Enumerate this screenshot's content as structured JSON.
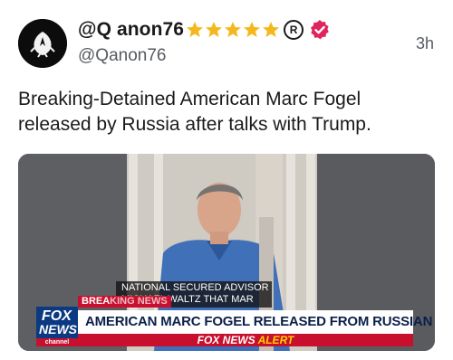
{
  "post": {
    "display_name": "@Q anon76",
    "handle": "@Qanon76",
    "timestamp": "3h",
    "text": "Breaking-Detained American Marc Fogel released by Russia after talks with Trump.",
    "star_count": 5,
    "registered_symbol": "R"
  },
  "media": {
    "caption_line_1": "NATIONAL SECURED ADVISOR",
    "caption_line_2": "MICHAEL WALTZ THAT MAR",
    "breaking_label": "BREA",
    "breaking_tail": "KING NEWS",
    "headline": "AMERICAN MARC FOGEL RELEASED FROM RUSSIAN CUSTODY",
    "logo_fox": "FOX",
    "logo_news": "NEWS",
    "logo_channel": "channel",
    "alert_brand": "FOX NEWS",
    "alert_word": "ALERT"
  },
  "colors": {
    "star": "#f5b81c",
    "verified": "#e0245e",
    "fox_blue": "#0b3a82",
    "fox_red": "#c8102e"
  },
  "icons": [
    "star-icon",
    "registered-icon",
    "verified-badge-icon"
  ]
}
